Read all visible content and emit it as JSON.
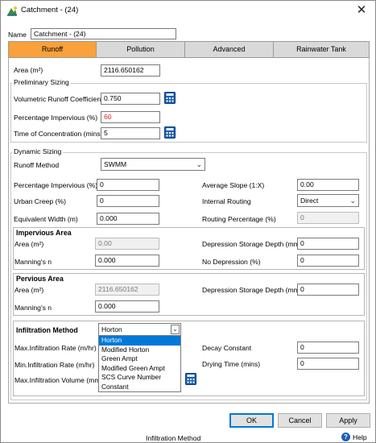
{
  "window": {
    "title": "Catchment - (24)",
    "close_glyph": "✕"
  },
  "name": {
    "label": "Name",
    "value": "Catchment - (24)"
  },
  "tabs": [
    "Runoff",
    "Pollution",
    "Advanced",
    "Rainwater Tank"
  ],
  "area": {
    "label": "Area (m²)",
    "value": "2116.650162"
  },
  "preliminary": {
    "title": "Preliminary Sizing",
    "runoff_coeff": {
      "label": "Volumetric Runoff Coefficient",
      "value": "0.750"
    },
    "pct_impervious": {
      "label": "Percentage Impervious (%)",
      "value": "60"
    },
    "time_conc": {
      "label": "Time of Concentration (mins)",
      "value": "5"
    }
  },
  "dynamic": {
    "title": "Dynamic Sizing",
    "method": {
      "label": "Runoff Method",
      "value": "SWMM"
    },
    "pct_impervious": {
      "label": "Percentage Impervious (%)",
      "value": "0"
    },
    "urban_creep": {
      "label": "Urban Creep (%)",
      "value": "0"
    },
    "equiv_width": {
      "label": "Equivalent Width (m)",
      "value": "0.000"
    },
    "avg_slope": {
      "label": "Average Slope (1:X)",
      "value": "0.00"
    },
    "internal_routing": {
      "label": "Internal Routing",
      "value": "Direct"
    },
    "routing_pct": {
      "label": "Routing Percentage (%)",
      "value": "0"
    }
  },
  "impervious": {
    "title": "Impervious Area",
    "area": {
      "label": "Area (m²)",
      "value": "0.00"
    },
    "mannings": {
      "label": "Manning's n",
      "value": "0.000"
    },
    "dep_storage": {
      "label": "Depression Storage Depth (mm)",
      "value": "0"
    },
    "no_depression": {
      "label": "No Depression (%)",
      "value": "0"
    }
  },
  "pervious": {
    "title": "Pervious Area",
    "area": {
      "label": "Area (m²)",
      "value": "2116.650162"
    },
    "mannings": {
      "label": "Manning's n",
      "value": "0.000"
    },
    "dep_storage": {
      "label": "Depression Storage Depth (mm)",
      "value": "0"
    }
  },
  "infiltration": {
    "title": "Infiltration Method",
    "selected": "Horton",
    "options": [
      "Horton",
      "Modified Horton",
      "Green Ampt",
      "Modified Green Ampt",
      "SCS Curve Number",
      "Constant"
    ],
    "max_rate_label": "Max.Infiltration Rate (m/hr)",
    "min_rate_label": "Min.Infiltration Rate (m/hr)",
    "max_volume_label": "Max.Infiltration Volume (mm)",
    "decay": {
      "label": "Decay Constant",
      "value": "0"
    },
    "drying": {
      "label": "Drying Time (mins)",
      "value": "0"
    }
  },
  "buttons": {
    "ok": "OK",
    "cancel": "Cancel",
    "apply": "Apply"
  },
  "status_text": "Infiltration Method",
  "help": {
    "glyph": "?",
    "label": "Help"
  },
  "colors": {
    "active_tab": "#f9a13a",
    "warning_text": "#e02020",
    "selection": "#0078d7"
  }
}
